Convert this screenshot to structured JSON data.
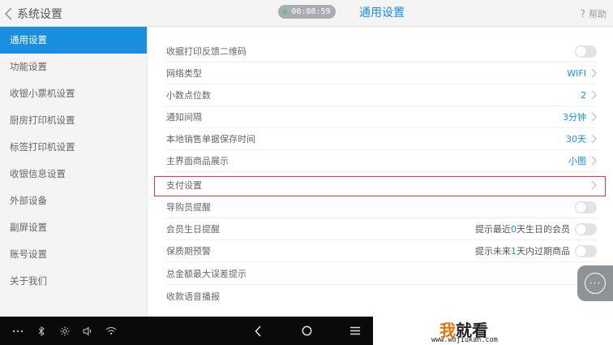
{
  "header": {
    "back_title": "系统设置",
    "timer": "00:08:59",
    "page_title": "通用设置",
    "help_label": "帮助"
  },
  "sidebar": {
    "items": [
      {
        "label": "通用设置",
        "active": true
      },
      {
        "label": "功能设置"
      },
      {
        "label": "收银小票机设置"
      },
      {
        "label": "厨房打印机设置"
      },
      {
        "label": "标签打印机设置"
      },
      {
        "label": "收银信息设置"
      },
      {
        "label": "外部设备"
      },
      {
        "label": "副屏设置"
      },
      {
        "label": "账号设置"
      },
      {
        "label": "关于我们"
      }
    ]
  },
  "settings": {
    "receipt_qr": {
      "label": "收据打印反馈二维码",
      "toggle": "off"
    },
    "network": {
      "label": "网络类型",
      "value": "WIFI"
    },
    "decimals": {
      "label": "小数点位数",
      "value": "2"
    },
    "notify_interval": {
      "label": "通知间隔",
      "value": "3分钟"
    },
    "local_save": {
      "label": "本地销售单据保存时间",
      "value": "30天"
    },
    "main_display": {
      "label": "主界面商品展示",
      "value": "小图"
    },
    "payment": {
      "label": "支付设置"
    },
    "guide_reminder": {
      "label": "导购员提醒",
      "toggle": "off"
    },
    "birthday": {
      "label": "会员生日提醒",
      "hint_prefix": "提示最近",
      "hint_num": "0",
      "hint_suffix": "天生日的会员",
      "toggle": "off"
    },
    "expiry": {
      "label": "保质期预警",
      "hint_prefix": "提示未来",
      "hint_num": "1",
      "hint_suffix": "天内过期商品",
      "toggle": "off"
    },
    "max_error": {
      "label": "总金额最大误差提示"
    },
    "voice": {
      "label": "收款语音播报"
    }
  },
  "float_button": {
    "glyph": "···"
  },
  "watermark": {
    "wo": "我",
    "rest": "就看",
    "url": "www.wojiukan.com"
  },
  "colors": {
    "accent": "#1a8fe0",
    "highlight": "#e23c3c",
    "sidebar_bg": "#f4f4f4"
  }
}
